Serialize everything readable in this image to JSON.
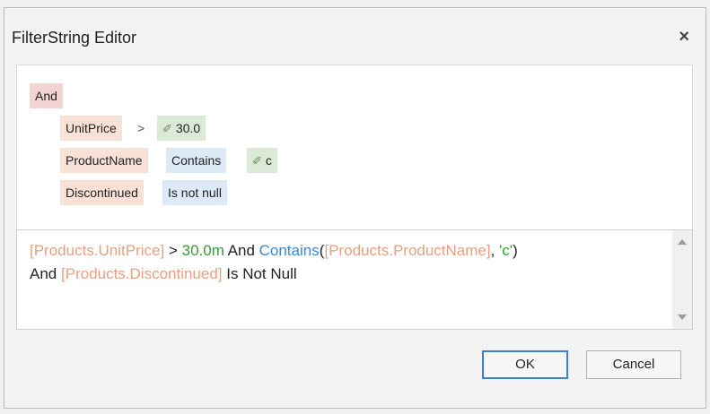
{
  "dialog": {
    "title": "FilterString Editor",
    "close_glyph": "×"
  },
  "filter_tree": {
    "root_group": "And",
    "conditions": [
      {
        "field": "UnitPrice",
        "operator": ">",
        "value": "30.0"
      },
      {
        "field": "ProductName",
        "operator": "Contains",
        "value": "c"
      },
      {
        "field": "Discontinued",
        "operator": "Is not null"
      }
    ],
    "value_icon": "pencil-icon",
    "pencil_glyph": "✐"
  },
  "expression": {
    "segments": [
      {
        "text": "[Products.UnitPrice]",
        "kind": "field"
      },
      {
        "text": " > ",
        "kind": "kw"
      },
      {
        "text": "30.0m",
        "kind": "num"
      },
      {
        "text": " And ",
        "kind": "kw"
      },
      {
        "text": "Contains",
        "kind": "fn"
      },
      {
        "text": "(",
        "kind": "kw"
      },
      {
        "text": "[Products.ProductName]",
        "kind": "field"
      },
      {
        "text": ", ",
        "kind": "kw"
      },
      {
        "text": "'c'",
        "kind": "num"
      },
      {
        "text": ")",
        "kind": "kw"
      },
      {
        "text": "And ",
        "kind": "kw",
        "newline_before": true
      },
      {
        "text": "[Products.Discontinued]",
        "kind": "field"
      },
      {
        "text": " Is Not Null",
        "kind": "kw"
      }
    ]
  },
  "buttons": {
    "ok": "OK",
    "cancel": "Cancel"
  },
  "colors": {
    "group_chip": "#f4d4d0",
    "field_chip": "#f8e2d8",
    "operator_chip": "#dce9f6",
    "value_chip": "#dbead6",
    "field_text": "#e5a17f",
    "number_text": "#3a9a3a",
    "function_text": "#3b86d4",
    "ok_border": "#3c7fcf"
  }
}
